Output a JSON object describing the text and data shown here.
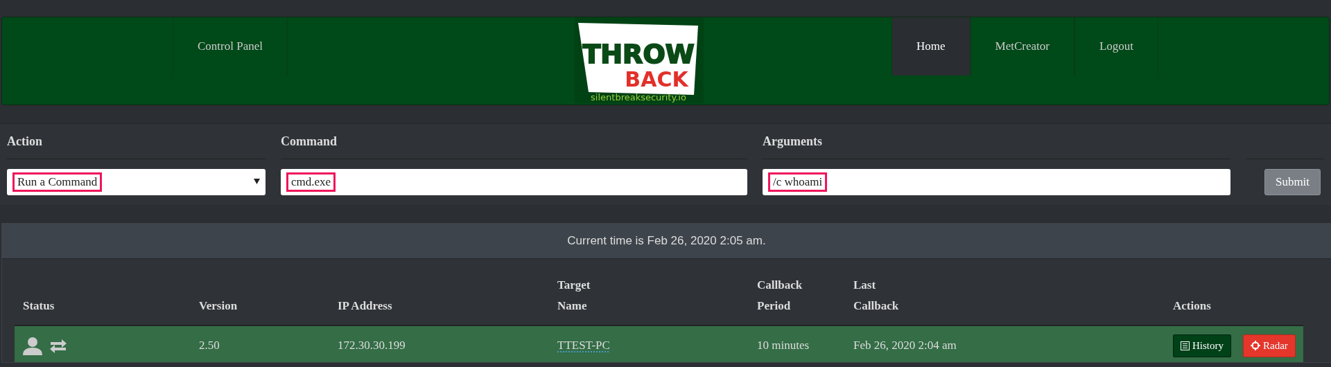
{
  "navbar": {
    "left_items": [
      {
        "label": "Control Panel",
        "selected": false
      }
    ],
    "logo": {
      "word_1": "THROW",
      "word_2": "BACK",
      "tagline": "silentbreaksecurity.io"
    },
    "right_items": [
      {
        "label": "Home",
        "selected": true
      },
      {
        "label": "MetCreator",
        "selected": false
      },
      {
        "label": "Logout",
        "selected": false
      }
    ]
  },
  "form": {
    "fields": [
      {
        "kind": "select",
        "label": "Action",
        "value": "Run a Command"
      },
      {
        "kind": "text",
        "label": "Command",
        "value": "cmd.exe"
      },
      {
        "kind": "text",
        "label": "Arguments",
        "value": "/c whoami"
      }
    ],
    "submit": "Submit"
  },
  "panel": {
    "heading": "Current time is Feb 26, 2020 2:05 am.",
    "table": {
      "columns": [
        "Status",
        "Version",
        "IP Address",
        "Target Name",
        "Callback Period",
        "Last Callback",
        "Actions"
      ],
      "rows": [
        {
          "version": "2.50",
          "ip": "172.30.30.199",
          "target": "TTEST-PC",
          "period": "10 minutes",
          "last": "Feb 26, 2020 2:04 am",
          "actions": [
            {
              "kind": "history",
              "label": "History"
            },
            {
              "kind": "radar",
              "label": "Radar"
            }
          ]
        }
      ]
    }
  }
}
